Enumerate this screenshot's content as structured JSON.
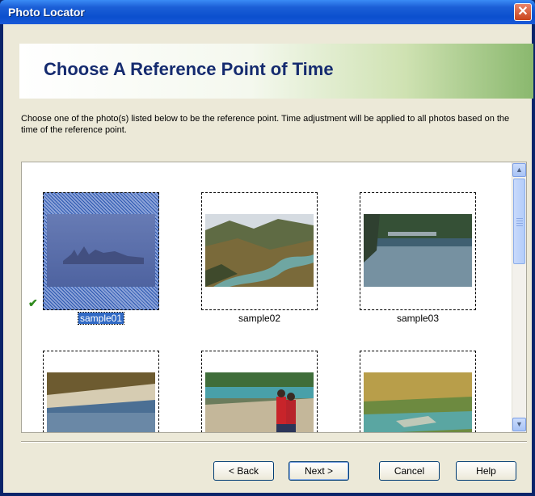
{
  "window": {
    "title": "Photo Locator",
    "close_symbol": "✕"
  },
  "header": {
    "title": "Choose A Reference Point of Time"
  },
  "description": "Choose one of the photo(s) listed below to be the reference point. Time adjustment will be applied to all photos based on the time of the reference point.",
  "gallery": {
    "items": [
      {
        "label": "sample01",
        "selected": true,
        "checked": true
      },
      {
        "label": "sample02",
        "selected": false,
        "checked": false
      },
      {
        "label": "sample03",
        "selected": false,
        "checked": false
      },
      {
        "label": "",
        "selected": false,
        "checked": false
      },
      {
        "label": "",
        "selected": false,
        "checked": false
      },
      {
        "label": "",
        "selected": false,
        "checked": false
      }
    ],
    "check_symbol": "✔"
  },
  "scrollbar": {
    "up_symbol": "▲",
    "down_symbol": "▼"
  },
  "buttons": {
    "back": "< Back",
    "next": "Next >",
    "cancel": "Cancel",
    "help": "Help"
  }
}
